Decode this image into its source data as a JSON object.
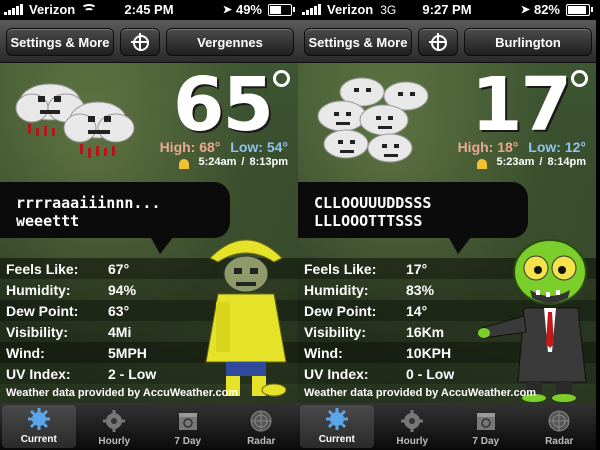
{
  "screens": [
    {
      "status": {
        "carrier": "Verizon",
        "network": "",
        "time": "2:45 PM",
        "battery": "49%",
        "battery_level": 0.49
      },
      "toolbar": {
        "settings_label": "Settings & More",
        "city": "Vergennes"
      },
      "current": {
        "temp": "65",
        "high_label": "High:",
        "high": "68°",
        "low_label": "Low:",
        "low": "54°",
        "sunrise": "5:24am",
        "sunset": "8:13pm"
      },
      "bubble": {
        "line1": "rrrraaaiiinnn...",
        "line2": "weeettt"
      },
      "details": [
        {
          "label": "Feels Like:",
          "value": "67°"
        },
        {
          "label": "Humidity:",
          "value": "94%"
        },
        {
          "label": "Dew Point:",
          "value": "63°"
        },
        {
          "label": "Visibility:",
          "value": "4Mi"
        },
        {
          "label": "Wind:",
          "value": "5MPH"
        },
        {
          "label": "UV Index:",
          "value": "2 - Low"
        }
      ],
      "credit": "Weather data provided by AccuWeather.com",
      "tabs": [
        {
          "label": "Current",
          "icon": "sun-gear-icon",
          "active": true
        },
        {
          "label": "Hourly",
          "icon": "clock-gear-icon",
          "active": false
        },
        {
          "label": "7 Day",
          "icon": "calendar-icon",
          "active": false
        },
        {
          "label": "Radar",
          "icon": "radar-icon",
          "active": false
        }
      ]
    },
    {
      "status": {
        "carrier": "Verizon",
        "network": "3G",
        "time": "9:27 PM",
        "battery": "82%",
        "battery_level": 0.82
      },
      "toolbar": {
        "settings_label": "Settings & More",
        "city": "Burlington"
      },
      "current": {
        "temp": "17",
        "high_label": "High:",
        "high": "18°",
        "low_label": "Low:",
        "low": "12°",
        "sunrise": "5:23am",
        "sunset": "8:14pm"
      },
      "bubble": {
        "line1": "CLLOOUUUDDSSS",
        "line2": "LLLOOOTTTSSS"
      },
      "details": [
        {
          "label": "Feels Like:",
          "value": "17°"
        },
        {
          "label": "Humidity:",
          "value": "83%"
        },
        {
          "label": "Dew Point:",
          "value": "14°"
        },
        {
          "label": "Visibility:",
          "value": "16Km"
        },
        {
          "label": "Wind:",
          "value": "10KPH"
        },
        {
          "label": "UV Index:",
          "value": "0 - Low"
        }
      ],
      "credit": "Weather data provided by AccuWeather.com",
      "tabs": [
        {
          "label": "Current",
          "icon": "sun-gear-icon",
          "active": true
        },
        {
          "label": "Hourly",
          "icon": "clock-gear-icon",
          "active": false
        },
        {
          "label": "7 Day",
          "icon": "calendar-icon",
          "active": false
        },
        {
          "label": "Radar",
          "icon": "radar-icon",
          "active": false
        }
      ]
    }
  ],
  "colors": {
    "high": "#e9a890",
    "low": "#8fc3ee",
    "raincoat": "#e6e22a",
    "zombie": "#7ccf2a"
  }
}
